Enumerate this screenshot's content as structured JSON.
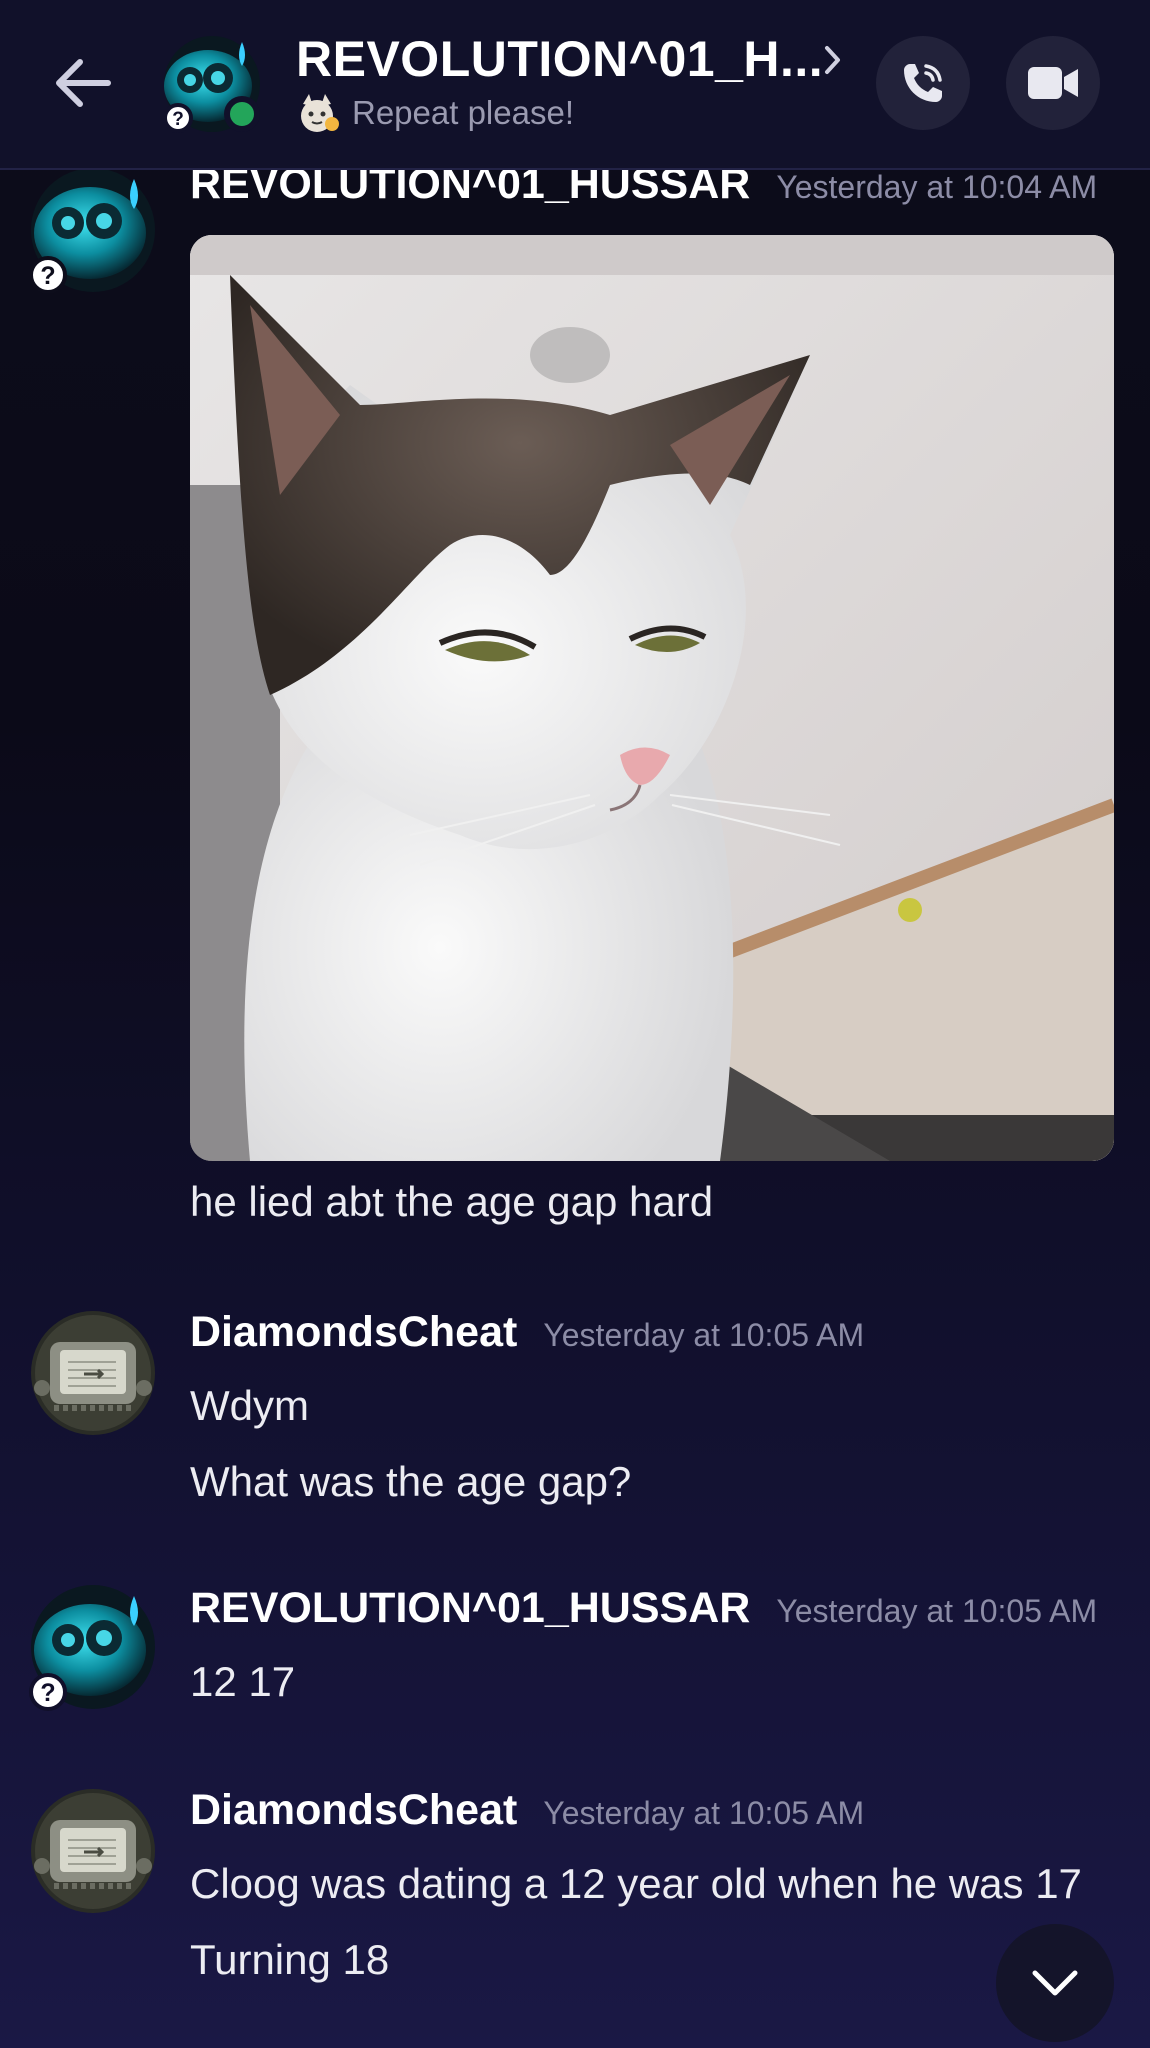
{
  "header": {
    "title": "REVOLUTION^01_H...",
    "status": "Repeat please!"
  },
  "messages": [
    {
      "author": "REVOLUTION^01_HUSSAR",
      "timestamp": "Yesterday at 10:04 AM",
      "attachment": "cat-photo",
      "lines": [
        "he lied abt the age gap hard"
      ]
    },
    {
      "author": "DiamondsCheat",
      "timestamp": "Yesterday at 10:05 AM",
      "lines": [
        "Wdym",
        "What was the age gap?"
      ]
    },
    {
      "author": "REVOLUTION^01_HUSSAR",
      "timestamp": "Yesterday at 10:05 AM",
      "lines": [
        "12 17"
      ]
    },
    {
      "author": "DiamondsCheat",
      "timestamp": "Yesterday at 10:05 AM",
      "lines": [
        "Cloog was dating a 12 year old when he was 17",
        "Turning 18"
      ]
    }
  ],
  "colors": {
    "header_bg": "#11112a",
    "online": "#23a55a",
    "muted_text": "#8c8ca6"
  }
}
